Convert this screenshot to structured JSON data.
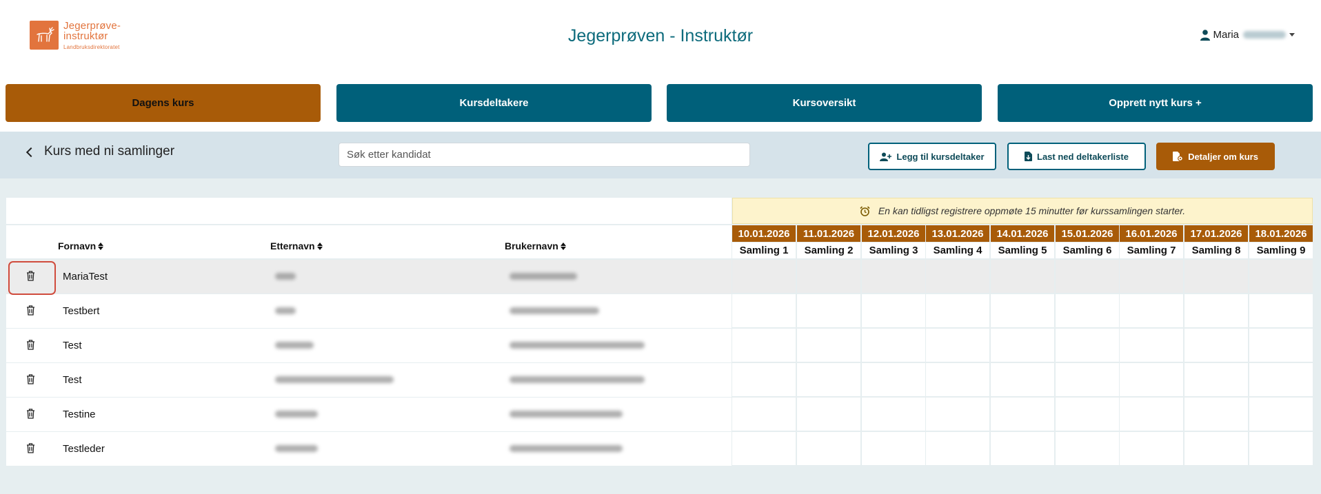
{
  "header": {
    "logo_line1": "Jegerprøve-",
    "logo_line2": "instruktør",
    "logo_line3": "Landbruksdirektoratet",
    "title": "Jegerprøven - Instruktør",
    "user_first": "Maria",
    "icons": {
      "user": "user-icon",
      "caret": "chevron-down-icon"
    }
  },
  "nav": {
    "dagens": "Dagens kurs",
    "deltakere": "Kursdeltakere",
    "oversikt": "Kursoversikt",
    "opprett": "Opprett nytt kurs +"
  },
  "toolbar": {
    "back_label": "Kurs med ni samlinger",
    "search_placeholder": "Søk etter kandidat",
    "add_participant": "Legg til kursdeltaker",
    "download_list": "Last ned deltakerliste",
    "course_details": "Detaljer om kurs"
  },
  "notice": "En kan tidligst registrere oppmøte 15 minutter før kurssamlingen starter.",
  "columns": {
    "fornavn": "Fornavn",
    "etternavn": "Etternavn",
    "brukernavn": "Brukernavn"
  },
  "sessions": [
    {
      "date": "10.01.2026",
      "label": "Samling 1"
    },
    {
      "date": "11.01.2026",
      "label": "Samling 2"
    },
    {
      "date": "12.01.2026",
      "label": "Samling 3"
    },
    {
      "date": "13.01.2026",
      "label": "Samling 4"
    },
    {
      "date": "14.01.2026",
      "label": "Samling 5"
    },
    {
      "date": "15.01.2026",
      "label": "Samling 6"
    },
    {
      "date": "16.01.2026",
      "label": "Samling 7"
    },
    {
      "date": "17.01.2026",
      "label": "Samling 8"
    },
    {
      "date": "18.01.2026",
      "label": "Samling 9"
    }
  ],
  "rows": [
    {
      "fornavn": "MariaTest",
      "selected": true
    },
    {
      "fornavn": "Testbert",
      "selected": false
    },
    {
      "fornavn": "Test",
      "selected": false
    },
    {
      "fornavn": "Test",
      "selected": false
    },
    {
      "fornavn": "Testine",
      "selected": false
    },
    {
      "fornavn": "Testleder",
      "selected": false
    }
  ],
  "colors": {
    "accent_orange": "#a85b08",
    "teal": "#00607a",
    "title_teal": "#0d6b7c",
    "band": "#d6e3ea",
    "notice_bg": "#fdf3cc",
    "selection_ring": "#d04b3c"
  }
}
